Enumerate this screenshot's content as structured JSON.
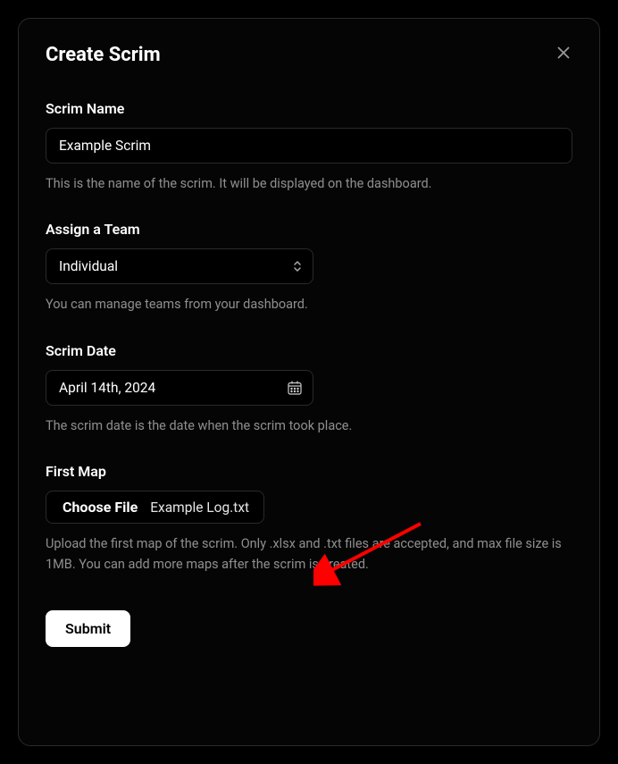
{
  "dialog": {
    "title": "Create Scrim"
  },
  "scrimName": {
    "label": "Scrim Name",
    "value": "Example Scrim",
    "help": "This is the name of the scrim. It will be displayed on the dashboard."
  },
  "team": {
    "label": "Assign a Team",
    "value": "Individual",
    "help": "You can manage teams from your dashboard."
  },
  "date": {
    "label": "Scrim Date",
    "value": "April 14th, 2024",
    "help": "The scrim date is the date when the scrim took place."
  },
  "firstMap": {
    "label": "First Map",
    "chooseLabel": "Choose File",
    "fileName": "Example Log.txt",
    "help": "Upload the first map of the scrim. Only .xlsx and .txt files are accepted, and max file size is 1MB. You can add more maps after the scrim is created."
  },
  "submit": {
    "label": "Submit"
  }
}
